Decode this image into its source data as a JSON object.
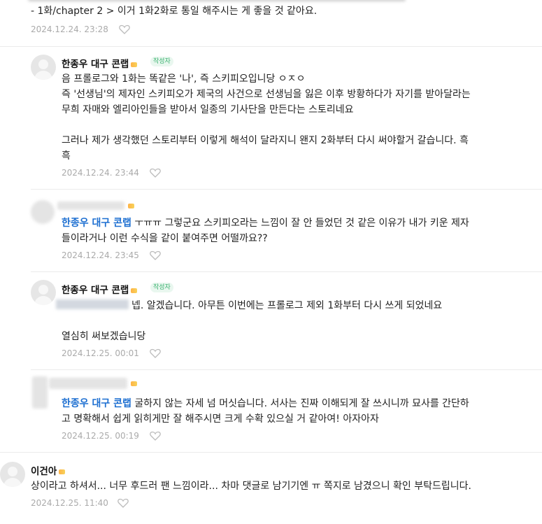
{
  "top_partial": {
    "text": "- 1화/chapter 2 > 이거 1화2화로 통일 해주시는 게 좋을 것 같아요.",
    "date": "2024.12.24. 23:28"
  },
  "comments": [
    {
      "author": "한종우 대구 콘랩",
      "badge": "작성자",
      "lines": [
        "음 프롤로그와 1화는 똑같은 '나', 즉 스키피오입니당 ㅇㅈㅇ",
        "즉 '선생님'의 제자인 스키피오가 제국의 사건으로 선생님을 잃은 이후 방황하다가 자기를 받아달라는",
        "무희 자매와 엘리아인들을 받아서 일종의 기사단을 만든다는 스토리네요",
        "",
        "그러나 제가 생각했던 스토리부터 이렇게 해석이 달라지니 왠지 2화부터 다시 써야할거 갈습니다. 흑",
        "흑"
      ],
      "date": "2024.12.24. 23:44"
    },
    {
      "mention": "한종우 대구 콘랩",
      "lines": [
        " ㅜㅠㅠ 그렇군요 스키피오라는 느낌이 잘 안 들었던 것 같은 이유가 내가 키운 제자",
        "들이라거나 이런 수식을 같이 붙여주면 어떨까요??"
      ],
      "date": "2024.12.24. 23:45"
    },
    {
      "author": "한종우 대구 콘랩",
      "badge": "작성자",
      "lines": [
        "넵. 알겠습니다. 아무튼 이번에는 프롤로그 제외 1화부터 다시 쓰게 되었네요",
        "",
        "열심히 써보겠습니당"
      ],
      "date": "2024.12.25. 00:01"
    },
    {
      "mention": "한종우 대구 콘랩",
      "lines": [
        " 굴하지 않는 자세 넘 머싯습니다. 서사는 진짜 이해되게 잘 쓰시니까 묘사를 간단하",
        "고 명확해서 쉽게 읽히게만 잘 해주시면 크게 수확 있으실 거 같아여! 아자아자"
      ],
      "date": "2024.12.25. 00:19"
    },
    {
      "author": "이건아",
      "lines": [
        "상이라고 하셔서... 너무 후드러 팬 느낌이라... 차마 댓글로 남기기엔 ㅠ 쪽지로 남겼으니 확인 부탁드립니다."
      ],
      "date": "2024.12.25. 11:40"
    }
  ],
  "icons": {
    "like": "heart-outline-icon",
    "avatar": "default-avatar-icon",
    "level": "level-badge-icon"
  },
  "colors": {
    "mention": "#1d6fd1",
    "meta": "#aaaaaa",
    "badge": "#3cb371",
    "divider": "#ebebeb"
  }
}
